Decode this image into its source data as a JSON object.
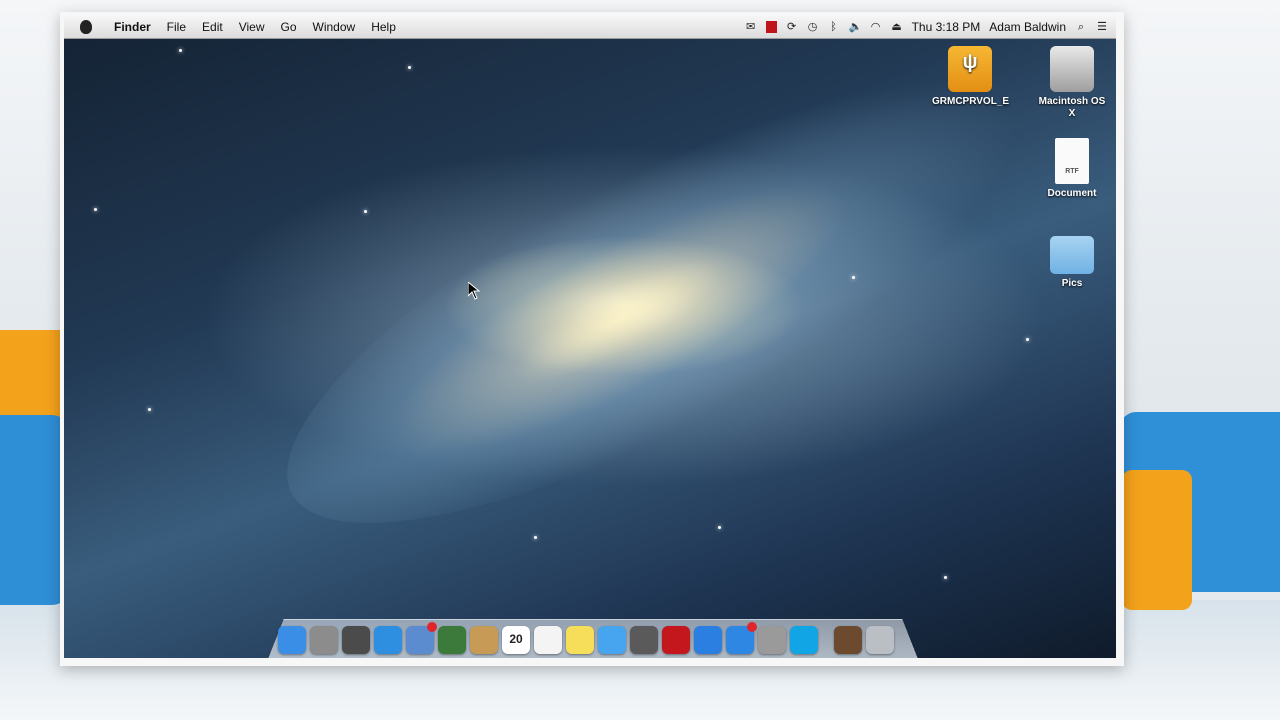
{
  "menu_bar": {
    "app_name": "Finder",
    "items": [
      "File",
      "Edit",
      "View",
      "Go",
      "Window",
      "Help"
    ],
    "clock": "Thu 3:18 PM",
    "user_name": "Adam Baldwin"
  },
  "desktop": {
    "icons": [
      {
        "label": "GRMCPRVOL_E",
        "icon": "usb-drive-icon"
      },
      {
        "label": "Macintosh OS X",
        "icon": "hard-drive-icon"
      },
      {
        "label": "Document",
        "icon": "rtf-document-icon",
        "file_type": "RTF"
      },
      {
        "label": "Pics",
        "icon": "folder-icon"
      }
    ]
  },
  "dock": {
    "calendar_day": "20",
    "items": [
      {
        "name": "finder",
        "color": "#3a8ee6"
      },
      {
        "name": "launchpad",
        "color": "#8c8c8c"
      },
      {
        "name": "mission-control",
        "color": "#4b4b4b"
      },
      {
        "name": "safari",
        "color": "#2e8fe0"
      },
      {
        "name": "mail",
        "color": "#5a8ccf"
      },
      {
        "name": "photo-booth",
        "color": "#3c7a3c"
      },
      {
        "name": "contacts",
        "color": "#c79a55"
      },
      {
        "name": "calendar",
        "color": "#ffffff"
      },
      {
        "name": "reminders",
        "color": "#f4f4f4"
      },
      {
        "name": "notes",
        "color": "#f7de5a"
      },
      {
        "name": "messages",
        "color": "#47a4ee"
      },
      {
        "name": "facetime",
        "color": "#5a5a5a"
      },
      {
        "name": "photo-booth-red",
        "color": "#c4161d"
      },
      {
        "name": "itunes",
        "color": "#2b7fe1"
      },
      {
        "name": "app-store",
        "color": "#2f87e4"
      },
      {
        "name": "system-preferences",
        "color": "#9a9a9a"
      },
      {
        "name": "skype",
        "color": "#12a5e6"
      },
      {
        "name": "pictures-stack",
        "color": "#6c4a2f"
      },
      {
        "name": "trash",
        "color": "#b9bfc4"
      }
    ]
  }
}
